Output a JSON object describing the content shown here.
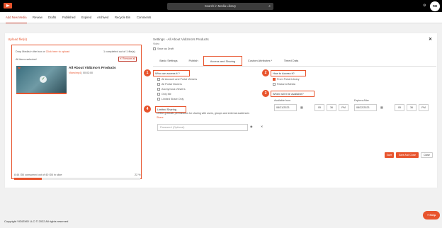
{
  "colors": {
    "accent": "#e8542d",
    "topbar": "#000000",
    "panel": "#ffffff"
  },
  "topbar": {
    "search_label": "Search in Media Library",
    "search_icon": "search-icon",
    "dropdown_icon": "chevron-down-icon",
    "user_initials": "RB"
  },
  "nav": {
    "items": [
      "Add New Media",
      "Review",
      "Drafts",
      "Published",
      "Expired",
      "Archived",
      "Recycle Bin",
      "Comments"
    ],
    "active": "Add New Media"
  },
  "upload": {
    "title": "Upload file(s)",
    "drop_text": "Drop Media in the box or",
    "drop_link": "Click here to upload",
    "completed_text": "1 completed out of 1 file(s)",
    "selected_text": "All items selected",
    "remove_all": "Remove all",
    "video": {
      "title": "All About Vidizmo's Products",
      "type": "Video/mp4",
      "duration": "00:02:00"
    },
    "storage_text": "8.44 GB consumed out of 40 GB in slice",
    "storage_percent": "22 %",
    "storage_fraction": 0.22
  },
  "settings": {
    "title": "Settings - All About Vidizmo's Products",
    "subtitle": "Video",
    "save_draft": "Save as Draft",
    "close_icon": "close-icon",
    "tabs": [
      "Basic Settings",
      "Publish",
      "Access and Sharing",
      "Custom Attributes *",
      "Timed Data"
    ],
    "active_tab": "Access and Sharing"
  },
  "access": {
    "markers": [
      "1",
      "2",
      "3",
      "4"
    ],
    "who_label": "Who can access it ?",
    "who_options": [
      {
        "label": "All Account and Portal Viewers",
        "checked": false
      },
      {
        "label": "All Portal Viewers",
        "checked": false
      },
      {
        "label": "Anonymous Viewers",
        "checked": false
      },
      {
        "label": "Only Me",
        "checked": false
      },
      {
        "label": "Limited Share Only",
        "checked": false
      }
    ],
    "how_label": "How to Access it?",
    "how_options": [
      {
        "label": "From Portal Library",
        "checked": true
      },
      {
        "label": "Featured Media",
        "checked": false
      }
    ],
    "when_label": "When will it be available?",
    "available_from_label": "Available from",
    "available_from_date": "08/21/2023",
    "available_from_hour": "05",
    "available_from_min": "36",
    "available_from_ampm": "PM",
    "expires_after_label": "Expires After",
    "expires_after_date": "08/22/2023",
    "expires_after_hour": "05",
    "expires_after_min": "36",
    "expires_after_ampm": "PM",
    "limited_label": "Limited Sharing",
    "limited_desc": "Define granular permissions for sharing with users, groups and external audiences",
    "share_link": "Share",
    "password_placeholder": "Password (Optional)",
    "password_toggle": "show",
    "password_clear": "✕"
  },
  "actions": {
    "save": "Save",
    "save_close": "Save And Close",
    "close": "Close"
  },
  "footer": {
    "copyright": "Copyright VIDIZMO LLC © 2022 All rights reserved"
  },
  "help": {
    "label": "Help"
  }
}
